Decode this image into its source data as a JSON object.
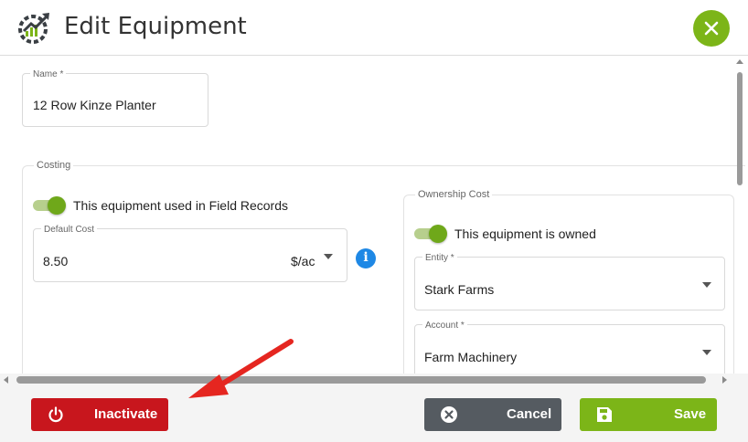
{
  "header": {
    "title": "Edit Equipment"
  },
  "name_field": {
    "label": "Name *",
    "value": "12 Row Kinze Planter"
  },
  "costing": {
    "section_label": "Costing",
    "field_records_toggle": {
      "label": "This equipment used in Field Records",
      "on": true
    },
    "default_cost": {
      "label": "Default Cost",
      "value": "8.50",
      "unit": "$/ac"
    }
  },
  "ownership": {
    "section_label": "Ownership Cost",
    "owned_toggle": {
      "label": "This equipment is owned",
      "on": true
    },
    "entity": {
      "label": "Entity *",
      "value": "Stark Farms"
    },
    "account": {
      "label": "Account *",
      "value": "Farm Machinery"
    }
  },
  "footer": {
    "inactivate_label": "Inactivate",
    "cancel_label": "Cancel",
    "save_label": "Save"
  },
  "colors": {
    "accent_green": "#7cb518",
    "danger_red": "#c8161d",
    "neutral_gray": "#555b61",
    "info_blue": "#1e88e5",
    "annotation_arrow": "#e52620"
  },
  "icons": [
    "growth-chart-logo",
    "close-icon",
    "info-icon",
    "power-icon",
    "cancel-x-icon",
    "save-icon",
    "annotation-arrow"
  ]
}
